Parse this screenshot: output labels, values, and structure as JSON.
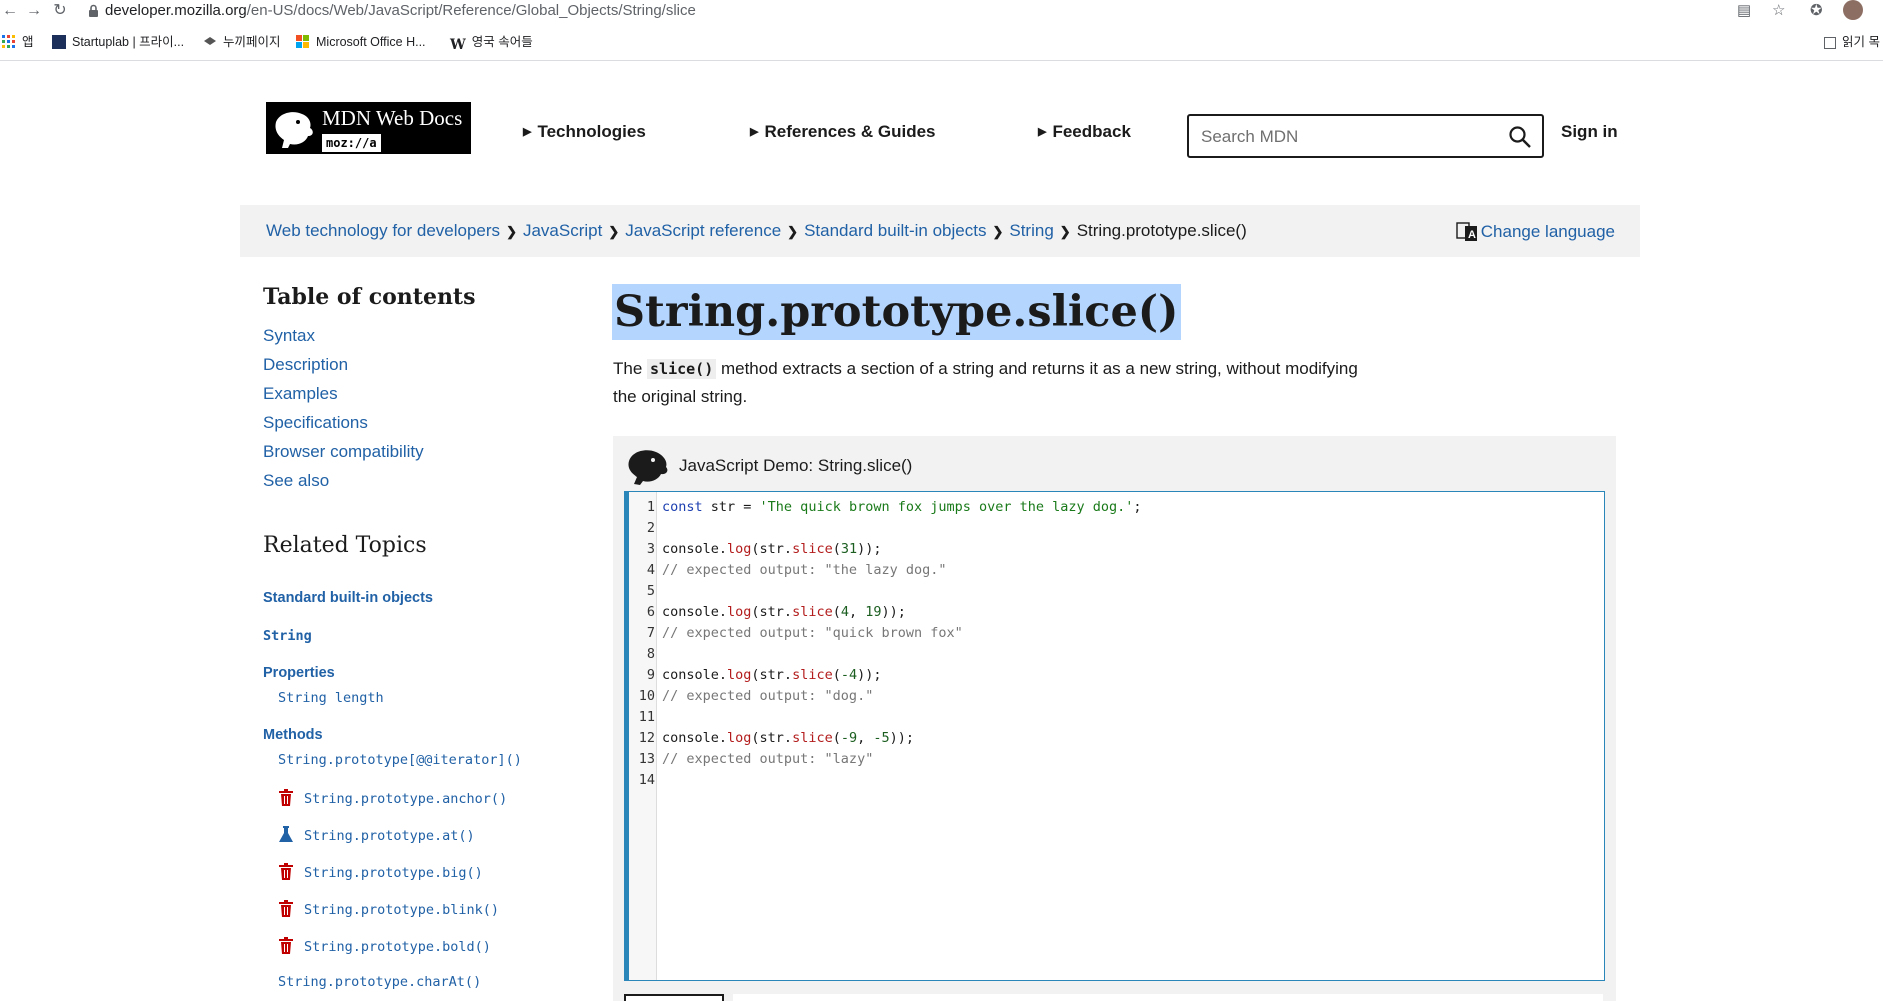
{
  "browser": {
    "url_host": "developer.mozilla.org",
    "url_path": "/en-US/docs/Web/JavaScript/Reference/Global_Objects/String/slice",
    "bookmarks": [
      {
        "label": "앱",
        "icon": "apps-grid-icon"
      },
      {
        "label": "Startuplab | 프라이...",
        "icon": "startuplab-favicon"
      },
      {
        "label": "누끼페이지",
        "icon": "layers-favicon"
      },
      {
        "label": "Microsoft Office H...",
        "icon": "microsoft-favicon"
      },
      {
        "label": "영국 속어들",
        "icon": "w-favicon"
      }
    ],
    "reading_list_label": "읽기 목"
  },
  "header": {
    "logo_title": "MDN Web Docs",
    "logo_sub": "moz://a",
    "nav": [
      "Technologies",
      "References & Guides",
      "Feedback"
    ],
    "search_placeholder": "Search MDN",
    "signin": "Sign in"
  },
  "breadcrumb": {
    "items": [
      "Web technology for developers",
      "JavaScript",
      "JavaScript reference",
      "Standard built-in objects",
      "String"
    ],
    "current": "String.prototype.slice()",
    "change_language": "Change language"
  },
  "toc": {
    "title": "Table of contents",
    "items": [
      "Syntax",
      "Description",
      "Examples",
      "Specifications",
      "Browser compatibility",
      "See also"
    ]
  },
  "related": {
    "title": "Related Topics",
    "builtins": "Standard built-in objects",
    "string": "String",
    "properties_h": "Properties",
    "properties": [
      "String length"
    ],
    "methods_h": "Methods",
    "methods": [
      {
        "label": "String.prototype[@@iterator]()",
        "icon": ""
      },
      {
        "label": "String.prototype.anchor()",
        "icon": "trash-deprecated-icon"
      },
      {
        "label": "String.prototype.at()",
        "icon": "flask-experimental-icon"
      },
      {
        "label": "String.prototype.big()",
        "icon": "trash-deprecated-icon"
      },
      {
        "label": "String.prototype.blink()",
        "icon": "trash-deprecated-icon"
      },
      {
        "label": "String.prototype.bold()",
        "icon": "trash-deprecated-icon"
      },
      {
        "label": "String.prototype.charAt()",
        "icon": ""
      }
    ]
  },
  "main": {
    "title": "String.prototype.slice()",
    "intro_before": "The ",
    "intro_code": "slice()",
    "intro_after": " method extracts a section of a string and returns it as a new string, without modifying the original string.",
    "demo_title": "JavaScript Demo: String.slice()"
  },
  "code_lines": [
    "const str = 'The quick brown fox jumps over the lazy dog.';",
    "",
    "console.log(str.slice(31));",
    "// expected output: \"the lazy dog.\"",
    "",
    "console.log(str.slice(4, 19));",
    "// expected output: \"quick brown fox\"",
    "",
    "console.log(str.slice(-4));",
    "// expected output: \"dog.\"",
    "",
    "console.log(str.slice(-9, -5));",
    "// expected output: \"lazy\"",
    ""
  ],
  "colors": {
    "link": "#2161a6",
    "selection": "#b4d5fe",
    "editor_border": "#2a86b8",
    "deprecated_icon": "#c00000"
  }
}
